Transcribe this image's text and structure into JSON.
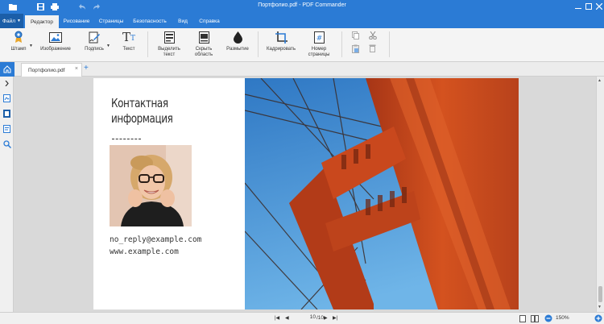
{
  "app": {
    "title": "Портфолио.pdf - PDF Commander"
  },
  "menu": {
    "file_label": "Файл",
    "tabs": [
      {
        "label": "Редактор",
        "active": true
      },
      {
        "label": "Рисование"
      },
      {
        "label": "Страницы"
      },
      {
        "label": "Безопасность"
      },
      {
        "label": "Вид"
      },
      {
        "label": "Справка"
      }
    ]
  },
  "ribbon": {
    "stamp": "Штамп",
    "image": "Изображение",
    "signature": "Подпись",
    "text": "Текст",
    "highlight_line1": "Выделить",
    "highlight_line2": "текст",
    "hide_line1": "Скрыть",
    "hide_line2": "область",
    "blur": "Размытие",
    "crop": "Кадрировать",
    "pagenum_line1": "Номер",
    "pagenum_line2": "страницы",
    "text_icon_glyph": "T"
  },
  "document_tab": {
    "name": "Портфолио.pdf"
  },
  "page": {
    "heading_line1": "Контактная",
    "heading_line2": "информация",
    "email": "no_reply@example.com",
    "website": "www.example.com"
  },
  "statusbar": {
    "current_page": "10",
    "total_pages": "/10",
    "zoom": "150%"
  },
  "colors": {
    "accent": "#2b7bd5",
    "accent_dark": "#1b5ea8",
    "sky": "#3f93d4",
    "bridge": "#c8441c"
  }
}
